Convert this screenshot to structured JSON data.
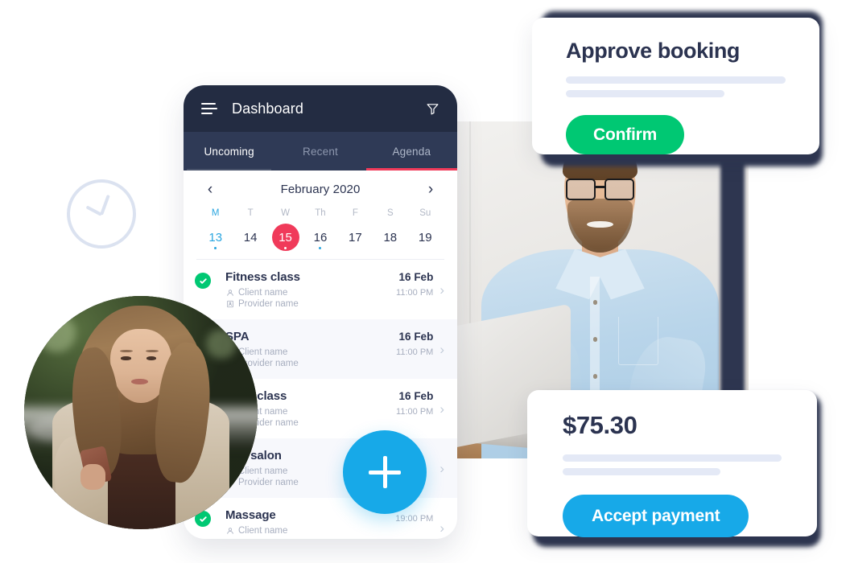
{
  "phone": {
    "menu_icon": "hamburger-icon",
    "title": "Dashboard",
    "filter_icon": "filter-icon",
    "tabs": [
      {
        "label": "Uncoming",
        "state": "light"
      },
      {
        "label": "Recent",
        "state": "inactive"
      },
      {
        "label": "Agenda",
        "state": "selected"
      }
    ],
    "calendar": {
      "prev_arrow": "‹",
      "next_arrow": "›",
      "month_label": "February 2020",
      "weekdays": [
        "M",
        "T",
        "W",
        "Th",
        "F",
        "S",
        "Su"
      ],
      "dates": [
        {
          "num": "13",
          "style": "blue"
        },
        {
          "num": "14",
          "style": "plain"
        },
        {
          "num": "15",
          "style": "today"
        },
        {
          "num": "16",
          "style": "bluedot"
        },
        {
          "num": "17",
          "style": "plain"
        },
        {
          "num": "18",
          "style": "plain"
        },
        {
          "num": "19",
          "style": "plain"
        }
      ],
      "today_color": "#f03a5a",
      "highlight_color": "#2ba6e0"
    },
    "appointments": [
      {
        "title": "Fitness class",
        "client": "Client name",
        "provider": "Provider name",
        "provider_icon": "building-icon",
        "provider_dot_color": "",
        "date": "16 Feb",
        "time": "11:00 PM",
        "status": "done",
        "chevron": "›"
      },
      {
        "title": "SPA",
        "client": "Client name",
        "provider": "Provider name",
        "provider_icon": "dot-icon",
        "provider_dot_color": "#f5b52a",
        "date": "16 Feb",
        "time": "11:00 PM",
        "status": "done",
        "chevron": "›"
      },
      {
        "title": "Yoga class",
        "client": "Client name",
        "provider": "Provider name",
        "provider_icon": "dot-icon",
        "provider_dot_color": "#00c873",
        "date": "16 Feb",
        "time": "11:00 PM",
        "status": "none",
        "chevron": "›"
      },
      {
        "title": "Nail salon",
        "client": "Client name",
        "provider": "Provider name",
        "provider_icon": "dot-icon",
        "provider_dot_color": "#f5b52a",
        "date": "",
        "time": "",
        "status": "none",
        "chevron": "›"
      },
      {
        "title": "Massage",
        "client": "Client name",
        "provider": "",
        "provider_icon": "",
        "provider_dot_color": "",
        "date": "",
        "time": "19:00 PM",
        "status": "done",
        "chevron": "›"
      }
    ],
    "fab": {
      "icon": "plus-icon",
      "color": "#17a9e8"
    }
  },
  "approve_card": {
    "title": "Approve booking",
    "confirm_label": "Confirm",
    "confirm_color": "#00c873"
  },
  "payment_card": {
    "amount": "$75.30",
    "accept_label": "Accept payment",
    "accept_color": "#17a9e8"
  },
  "decor": {
    "clock_icon": "clock-icon",
    "woman_photo": "woman-with-phone-photo",
    "man_photo": "man-at-laptop-photo",
    "navy_color": "#2e3650"
  }
}
